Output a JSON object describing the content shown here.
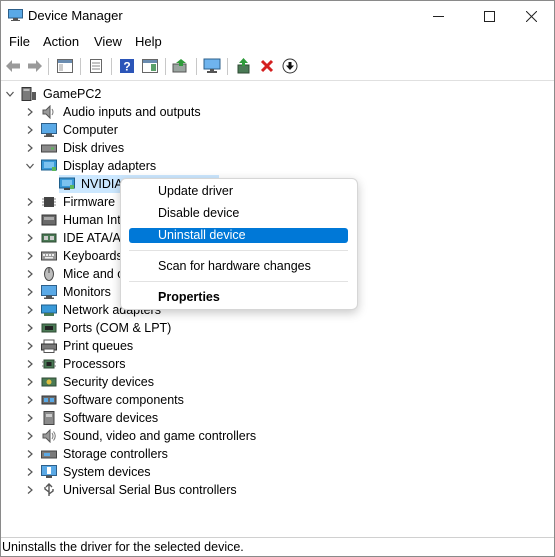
{
  "window": {
    "title": "Device Manager",
    "minimize": "—",
    "maximize": "☐",
    "close": "✕"
  },
  "menu": [
    "File",
    "Action",
    "View",
    "Help"
  ],
  "toolbar": {
    "icons": [
      "back-arrow-icon",
      "forward-arrow-icon",
      "show-hide-console-tree-icon",
      "properties-icon",
      "help-icon",
      "action-pane-icon",
      "update-driver-icon",
      "scan-hardware-icon",
      "enable-device-icon",
      "uninstall-device-icon",
      "disable-device-icon"
    ]
  },
  "tree": {
    "root": "GamePC2",
    "selected_device": "NVIDIA",
    "categories": [
      "Audio inputs and outputs",
      "Computer",
      "Disk drives",
      "Display adapters",
      "Firmware",
      "Human Int",
      "IDE ATA/AT",
      "Keyboards",
      "Mice and o",
      "Monitors",
      "Network adapters",
      "Ports (COM & LPT)",
      "Print queues",
      "Processors",
      "Security devices",
      "Software components",
      "Software devices",
      "Sound, video and game controllers",
      "Storage controllers",
      "System devices",
      "Universal Serial Bus controllers"
    ]
  },
  "context_menu": {
    "update": "Update driver",
    "disable": "Disable device",
    "uninstall": "Uninstall device",
    "scan": "Scan for hardware changes",
    "properties": "Properties"
  },
  "status": "Uninstalls the driver for the selected device.",
  "colors": {
    "highlight": "#0078d7",
    "selection": "#cce8ff"
  }
}
